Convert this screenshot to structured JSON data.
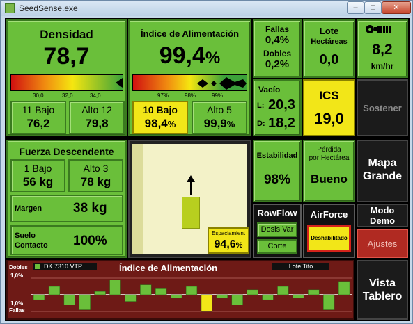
{
  "window": {
    "title": "SeedSense.exe",
    "min": "–",
    "max": "□",
    "close": "✕"
  },
  "density": {
    "title": "Densidad",
    "value": "78,7",
    "ticks": [
      "30,0",
      "32,0",
      "34,0"
    ],
    "low_label": "11 Bajo",
    "low_value": "76,2",
    "high_label": "Alto 12",
    "high_value": "79,8"
  },
  "feed": {
    "title": "Índice de Alimentación",
    "value": "99,4",
    "unit": "%",
    "ticks": [
      "97%",
      "98%",
      "99%"
    ],
    "low_label": "10 Bajo",
    "low_value": "98,4",
    "low_unit": "%",
    "high_label": "Alto 5",
    "high_value": "99,9",
    "high_unit": "%"
  },
  "fallas": {
    "label": "Fallas",
    "value": "0,4%",
    "dobles_label": "Dobles",
    "dobles_value": "0,2%"
  },
  "lote": {
    "label": "Lote",
    "sub": "Hectáreas",
    "value": "0,0"
  },
  "speed": {
    "value": "8,2",
    "unit": "km/hr",
    "icon": "tractor-icon"
  },
  "vacio": {
    "label": "Vacío",
    "l_label": "L:",
    "l_value": "20,3",
    "d_label": "D:",
    "d_value": "18,2"
  },
  "ics": {
    "label": "ICS",
    "value": "19,0"
  },
  "sostener": {
    "label": "Sostener"
  },
  "downforce": {
    "title": "Fuerza Descendente",
    "low_label": "1 Bajo",
    "low_value": "56 kg",
    "high_label": "Alto 3",
    "high_value": "78 kg",
    "margin_label": "Margen",
    "margin_value": "38 kg",
    "soil_label": "Suelo\nContacto",
    "soil_value": "100%"
  },
  "spacing": {
    "label": "Espaciamient",
    "value": "94,6",
    "unit": "%"
  },
  "stability": {
    "label": "Estabilidad",
    "value": "98%"
  },
  "loss": {
    "label": "Pérdida\npor Hectárea",
    "value": "Bueno"
  },
  "mapa": {
    "label": "Mapa\nGrande"
  },
  "rowflow": {
    "title": "RowFlow",
    "btn1": "Dosis Var",
    "btn2": "Corte"
  },
  "airforce": {
    "title": "AirForce",
    "status": "Deshabilitado"
  },
  "modo": {
    "label": "Modo\nDemo"
  },
  "ajustes": {
    "label": "Ajustes"
  },
  "vista": {
    "label": "Vista\nTablero"
  },
  "strip": {
    "hybrid": "DK 7310 VTP",
    "title": "Índice de Alimentación",
    "lote": "Lote Tito",
    "dobles": "Dobles",
    "top_pct": "1,0%",
    "bottom_pct": "1,0%",
    "fallas": "Fallas",
    "rows": [
      -0.3,
      0.5,
      -0.6,
      -0.9,
      0.2,
      0.9,
      -0.4,
      0.6,
      0.4,
      -0.2,
      0.5,
      -1.0,
      -0.2,
      -0.6,
      0.3,
      -0.3,
      0.5,
      -0.2,
      0.3,
      -0.9,
      0.8
    ],
    "highlight_row": 11
  },
  "colors": {
    "green": "#6abf3a",
    "yellow": "#f2e618",
    "dark": "#111111",
    "darkred": "#6e1a16",
    "red": "#d83a2a"
  }
}
